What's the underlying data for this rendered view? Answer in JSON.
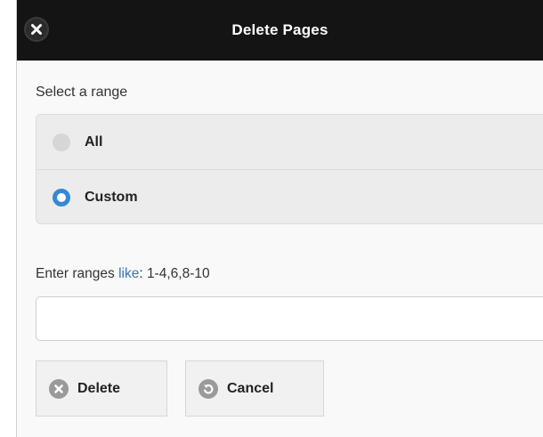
{
  "dialog": {
    "title": "Delete Pages"
  },
  "range": {
    "label": "Select a range",
    "options": [
      {
        "label": "All",
        "selected": false
      },
      {
        "label": "Custom",
        "selected": true
      }
    ]
  },
  "custom": {
    "hint_prefix": "Enter ranges ",
    "hint_highlight": "like",
    "hint_suffix": ": 1-4,6,8-10",
    "value": ""
  },
  "buttons": {
    "delete_label": "Delete",
    "cancel_label": "Cancel"
  },
  "colors": {
    "titlebar": "#141414",
    "accent": "#3688d4",
    "link": "#3a73b5"
  },
  "icons": {
    "close": "close-icon",
    "delete": "delete-circle-icon",
    "cancel": "undo-icon"
  }
}
